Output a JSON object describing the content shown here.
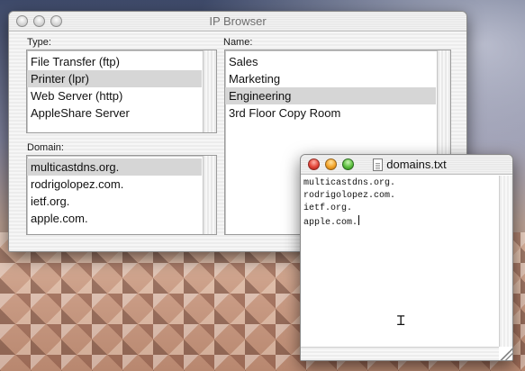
{
  "ip_browser": {
    "title": "IP Browser",
    "type_label": "Type:",
    "types": [
      {
        "label": "File Transfer (ftp)",
        "selected": false
      },
      {
        "label": "Printer (lpr)",
        "selected": true
      },
      {
        "label": "Web Server (http)",
        "selected": false
      },
      {
        "label": "AppleShare Server",
        "selected": false
      }
    ],
    "name_label": "Name:",
    "names": [
      {
        "label": "Sales",
        "selected": false
      },
      {
        "label": "Marketing",
        "selected": false
      },
      {
        "label": "Engineering",
        "selected": true
      },
      {
        "label": "3rd Floor Copy Room",
        "selected": false
      }
    ],
    "domain_label": "Domain:",
    "domains": [
      {
        "label": "multicastdns.org.",
        "selected": true
      },
      {
        "label": "rodrigolopez.com.",
        "selected": false
      },
      {
        "label": "ietf.org.",
        "selected": false
      },
      {
        "label": "apple.com.",
        "selected": false
      }
    ]
  },
  "text_window": {
    "title": "domains.txt",
    "lines": [
      "multicastdns.org.",
      "rodrigolopez.com.",
      "ietf.org.",
      "apple.com."
    ]
  },
  "cursor_icon": "ibeam-cursor-icon",
  "colors": {
    "selection": "#d6d6d6",
    "close": "#e3463a",
    "minimize": "#f3a42a",
    "zoom": "#5cbf3f"
  }
}
